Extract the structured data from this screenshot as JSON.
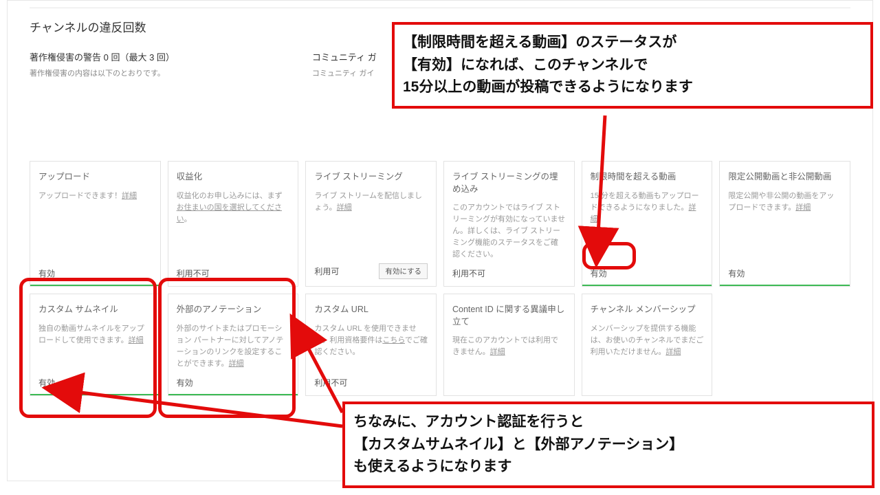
{
  "section_title": "チャンネルの違反回数",
  "violations": {
    "copyright_heading": "著作権侵害の警告 0 回（最大 3 回）",
    "copyright_sub": "著作権侵害の内容は以下のとおりです。",
    "community_heading": "コミュニティ ガ",
    "community_sub": "コミュニティ ガイ"
  },
  "detail_label": "詳細",
  "here_label": "こちら",
  "country_label": "お住まいの国を選択してください",
  "enable_button": "有効にする",
  "cards_row1": [
    {
      "title": "アップロード",
      "desc_pre": "アップロードできます！",
      "desc_post": "",
      "link": "detail",
      "status": "有効",
      "bar": "green",
      "btn": false
    },
    {
      "title": "収益化",
      "desc_pre": "収益化のお申し込みには、まず",
      "desc_post": "。",
      "link": "country",
      "status": "利用不可",
      "bar": "none",
      "btn": false
    },
    {
      "title": "ライブ ストリーミング",
      "desc_pre": "ライブ ストリームを配信しましょう。",
      "desc_post": "",
      "link": "detail",
      "status": "利用可",
      "bar": "none",
      "btn": true
    },
    {
      "title": "ライブ ストリーミングの埋め込み",
      "desc_pre": "このアカウントではライブ ストリーミングが有効になっていません。詳しくは、ライブ ストリーミング機能のステータスをご確認ください。",
      "desc_post": "",
      "link": "",
      "status": "利用不可",
      "bar": "none",
      "btn": false
    },
    {
      "title": "制限時間を超える動画",
      "desc_pre": "15 分を超える動画もアップロードできるようになりました。",
      "desc_post": "",
      "link": "detail",
      "status": "有効",
      "bar": "green",
      "btn": false
    },
    {
      "title": "限定公開動画と非公開動画",
      "desc_pre": "限定公開や非公開の動画をアップロードできます。",
      "desc_post": "",
      "link": "detail",
      "status": "有効",
      "bar": "green",
      "btn": false
    }
  ],
  "cards_row2": [
    {
      "title": "カスタム サムネイル",
      "desc_pre": "独自の動画サムネイルをアップロードして使用できます。",
      "desc_post": "",
      "link": "detail",
      "status": "有効",
      "bar": "green",
      "btn": false
    },
    {
      "title": "外部のアノテーション",
      "desc_pre": "外部のサイトまたはプロモーション パートナーに対してアノテーションのリンクを設定することができます。",
      "desc_post": "",
      "link": "detail",
      "status": "有効",
      "bar": "green",
      "btn": false
    },
    {
      "title": "カスタム URL",
      "desc_pre": "カスタム URL を使用できません。利用資格要件は",
      "desc_post": "でご確認ください。",
      "link": "here",
      "status": "利用不可",
      "bar": "none",
      "btn": false
    },
    {
      "title": "Content ID に関する異議申し立て",
      "desc_pre": "現在このアカウントでは利用できません。",
      "desc_post": "",
      "link": "detail",
      "status": "",
      "bar": "none",
      "btn": false
    },
    {
      "title": "チャンネル メンバーシップ",
      "desc_pre": "メンバーシップを提供する機能は、お使いのチャンネルでまだご利用いただけません。",
      "desc_post": "",
      "link": "detail",
      "status": "",
      "bar": "none",
      "btn": false
    }
  ],
  "annotation_top": "【制限時間を超える動画】のステータスが\n【有効】になれば、このチャンネルで\n15分以上の動画が投稿できるようになります",
  "annotation_bottom": "ちなみに、アカウント認証を行うと\n【カスタムサムネイル】と【外部アノテーション】\nも使えるようになります"
}
